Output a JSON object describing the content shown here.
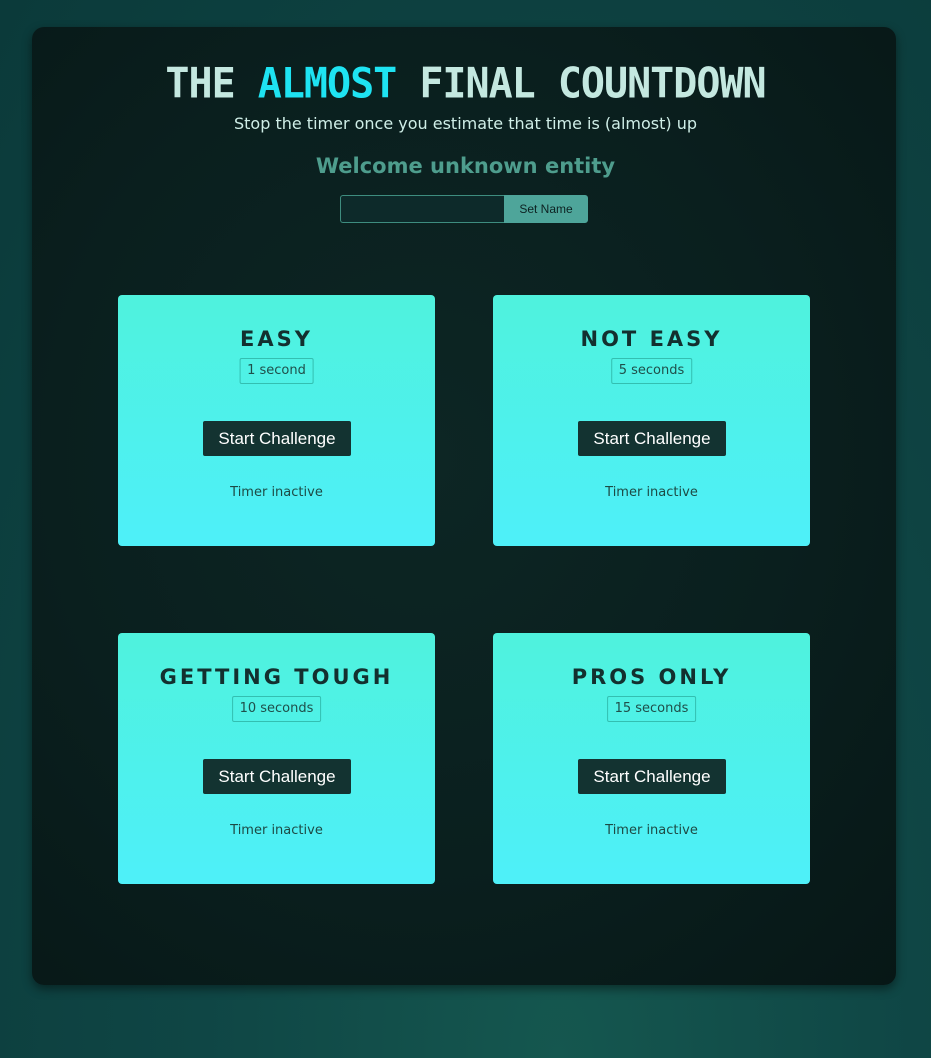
{
  "header": {
    "title_part1": "THE",
    "title_accent": "ALMOST",
    "title_part2": "FINAL COUNTDOWN",
    "subtitle": "Stop the timer once you estimate that time is (almost) up",
    "welcome": "Welcome unknown entity"
  },
  "name_form": {
    "input_value": "",
    "input_placeholder": "",
    "button_label": "Set Name"
  },
  "colors": {
    "accent": "#1ee3f2",
    "card_top": "#4ff2dd",
    "card_bottom": "#4ef0f9",
    "button_dark": "#133331",
    "welcome_text": "#4e9d8d"
  },
  "challenges": [
    {
      "title": "EASY",
      "duration": "1 second",
      "button_label": "Start Challenge",
      "status": "Timer inactive"
    },
    {
      "title": "NOT EASY",
      "duration": "5 seconds",
      "button_label": "Start Challenge",
      "status": "Timer inactive"
    },
    {
      "title": "GETTING TOUGH",
      "duration": "10 seconds",
      "button_label": "Start Challenge",
      "status": "Timer inactive"
    },
    {
      "title": "PROS ONLY",
      "duration": "15 seconds",
      "button_label": "Start Challenge",
      "status": "Timer inactive"
    }
  ]
}
